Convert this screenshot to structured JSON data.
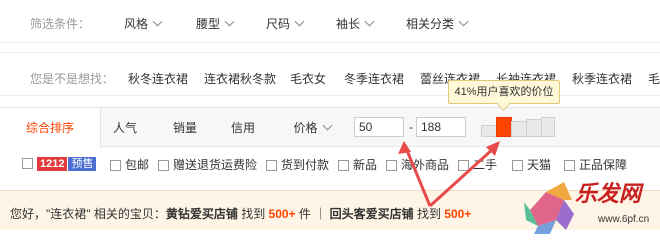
{
  "filters": {
    "label": "筛选条件：",
    "items": [
      {
        "label": "风格"
      },
      {
        "label": "腰型"
      },
      {
        "label": "尺码"
      },
      {
        "label": "袖长"
      },
      {
        "label": "相关分类"
      }
    ]
  },
  "suggestions": {
    "label": "您是不是想找：",
    "items": [
      "秋冬连衣裙",
      "连衣裙秋冬款",
      "毛衣女",
      "冬季连衣裙",
      "蕾丝连衣裙",
      "长袖连衣裙",
      "秋季连衣裙",
      "毛"
    ]
  },
  "sort": {
    "tabs": [
      "综合排序",
      "人气",
      "销量",
      "信用",
      "价格"
    ],
    "price_min": "50",
    "price_max": "188",
    "price_dash": "-",
    "tooltip": "41%用户喜欢的价位"
  },
  "checks": {
    "badge_1212": "1212",
    "badge_presale": "预售",
    "items": [
      "包邮",
      "赠送退货运费险",
      "货到付款",
      "新品",
      "海外商品",
      "二手",
      "天猫",
      "正品保障"
    ]
  },
  "notice": {
    "prefix": "您好，\"连衣裙\" 相关的宝贝：",
    "shop1": "黄钻爱买店铺",
    "found1": " 找到 ",
    "count1": "500+",
    "unit1": " 件 ｜ ",
    "shop2": "回头客爱买店铺",
    "found2": " 找到 ",
    "count2": "500+"
  },
  "watermark": {
    "text": "乐发网",
    "url": "www.6pf.cn"
  },
  "colors": {
    "accent": "#ff4400",
    "arrow": "#e84a4a"
  }
}
